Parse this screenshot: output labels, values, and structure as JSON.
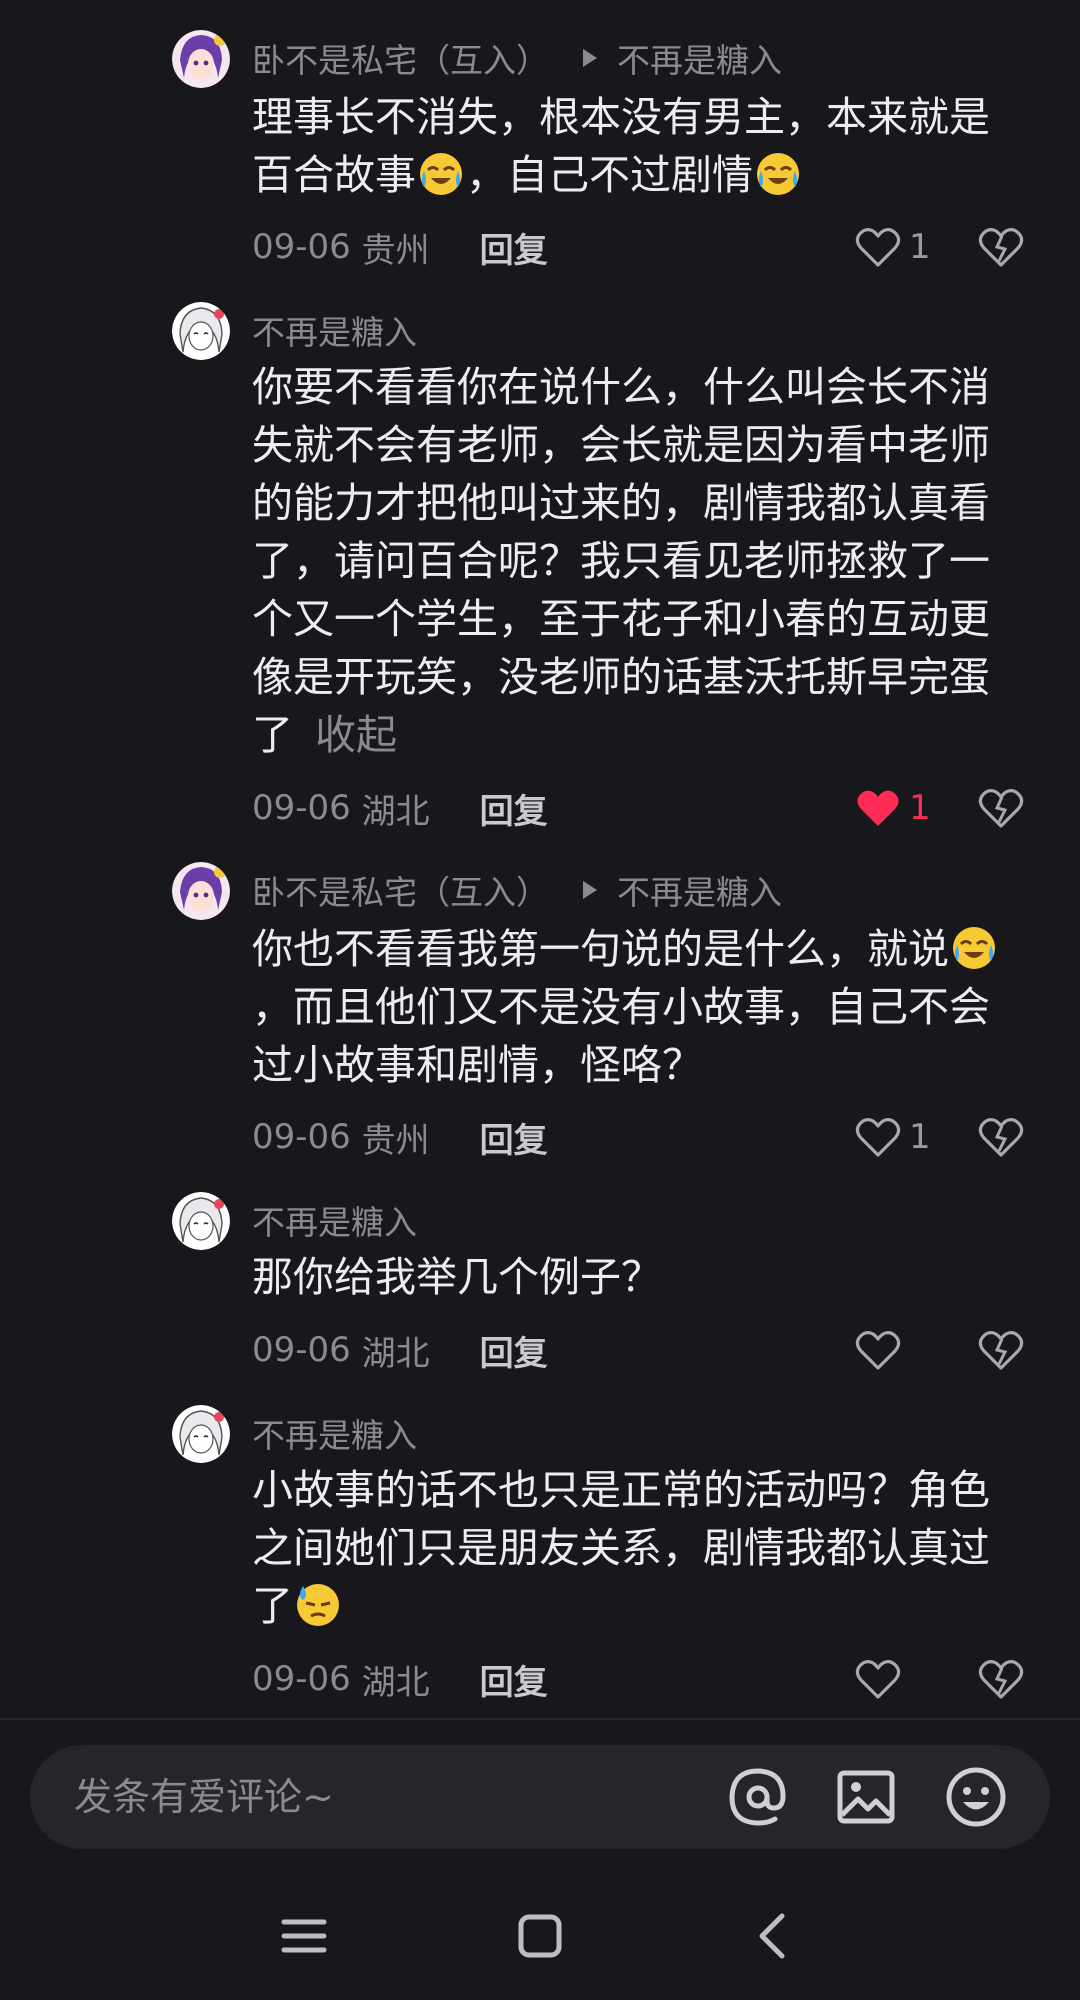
{
  "comments": [
    {
      "author": "卧不是私宅（互入）",
      "reply_to": "不再是糖入",
      "text_parts": [
        "理事长不消失，根本没有男主，本来就是百合故事",
        "，自己不过剧情",
        ""
      ],
      "date": "09-06",
      "location": "贵州",
      "reply_label": "回复",
      "likes": "1",
      "liked": false,
      "avatar_icon": "purple-hair-avatar"
    },
    {
      "author": "不再是糖入",
      "text": "你要不看看你在说什么，什么叫会长不消失就不会有老师，会长就是因为看中老师的能力才把他叫过来的，剧情我都认真看了，请问百合呢？我只看见老师拯救了一个又一个学生，至于花子和小春的互动更像是开玩笑，没老师的话基沃托斯早完蛋了",
      "collapse_label": "收起",
      "date": "09-06",
      "location": "湖北",
      "reply_label": "回复",
      "likes": "1",
      "liked": true,
      "avatar_icon": "white-hair-avatar"
    },
    {
      "author": "卧不是私宅（互入）",
      "reply_to": "不再是糖入",
      "text_parts": [
        "你也不看看我第一句说的是什么，就说",
        "，而且他们又不是没有小故事，自己不会过小故事和剧情，怪咯？"
      ],
      "date": "09-06",
      "location": "贵州",
      "reply_label": "回复",
      "likes": "1",
      "liked": false,
      "avatar_icon": "purple-hair-avatar"
    },
    {
      "author": "不再是糖入",
      "text": "那你给我举几个例子？",
      "date": "09-06",
      "location": "湖北",
      "reply_label": "回复",
      "likes": "",
      "liked": false,
      "avatar_icon": "white-hair-avatar"
    },
    {
      "author": "不再是糖入",
      "text_parts": [
        "小故事的话不也只是正常的活动吗？角色之间她们只是朋友关系，剧情我都认真过了",
        ""
      ],
      "date": "09-06",
      "location": "湖北",
      "reply_label": "回复",
      "likes": "",
      "liked": false,
      "avatar_icon": "white-hair-avatar"
    }
  ],
  "emojis": {
    "laugh_cry": "laugh-cry-emoji",
    "sweat": "sweat-emoji"
  },
  "composer": {
    "placeholder": "发条有爱评论~",
    "icons": [
      "at-icon",
      "image-icon",
      "emoji-icon"
    ]
  },
  "colors": {
    "background": "#17171c",
    "liked": "#fe2c55",
    "muted_text": "#8a8a91"
  }
}
